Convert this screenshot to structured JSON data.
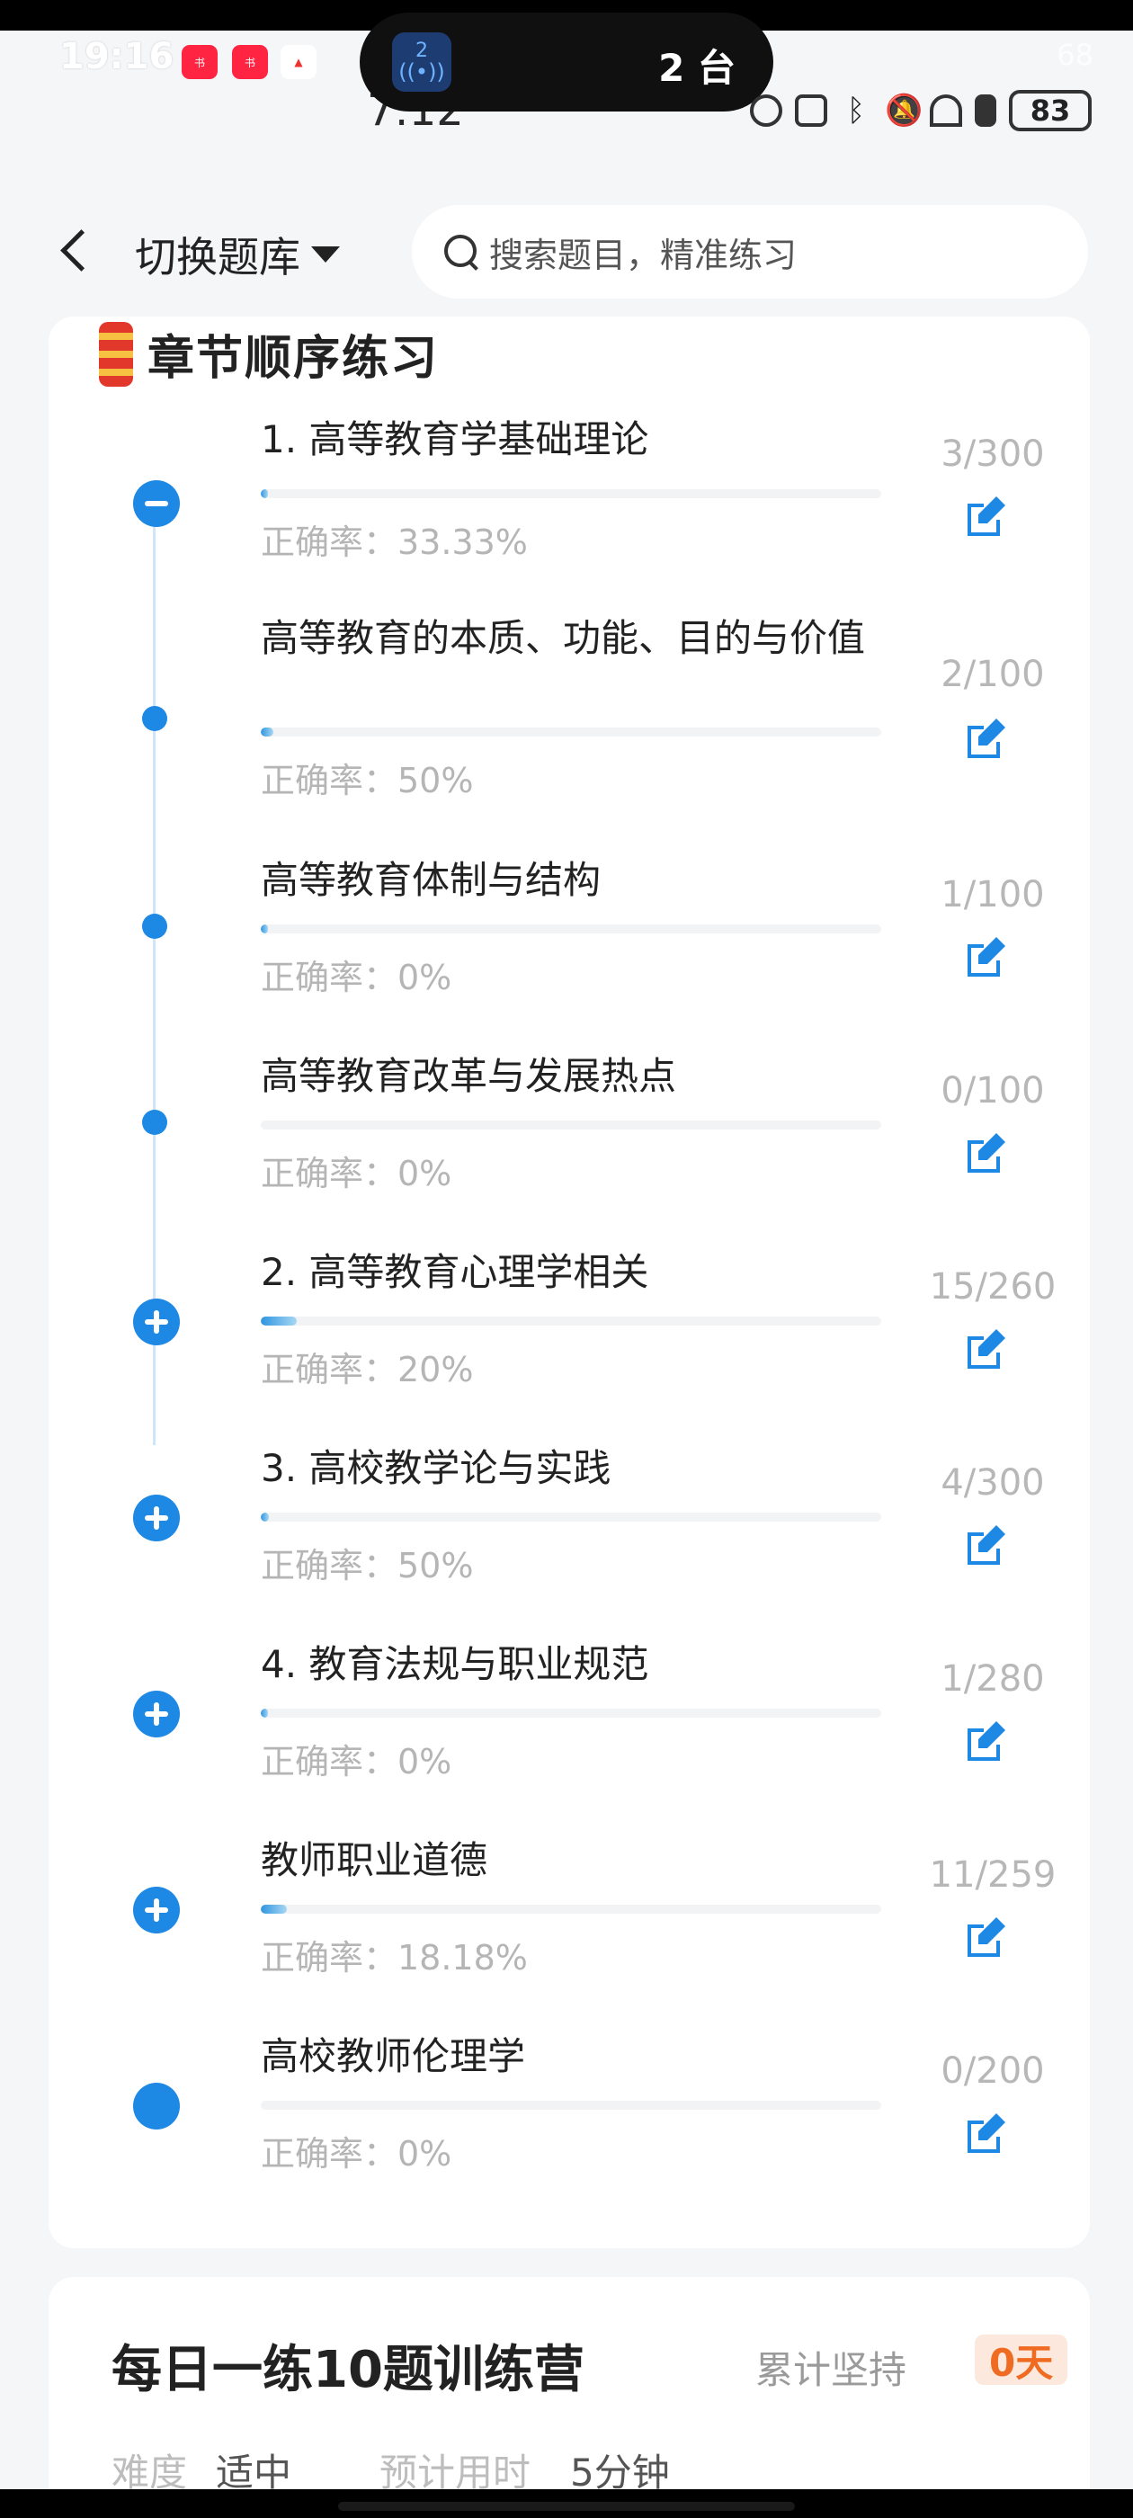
{
  "status_bar": {
    "ghost_time": "19:16",
    "time": "7:12",
    "island_badge": "2",
    "island_text": "2 台",
    "battery_ghost": "68",
    "battery": "83"
  },
  "header": {
    "switch_bank_label": "切换题库",
    "search_placeholder": "搜索题目，精准练习"
  },
  "chapter_card": {
    "title": "章节顺序练习",
    "items": [
      {
        "title": "1. 高等教育学基础理论",
        "count": "3/300",
        "accuracy": "正确率：33.33%",
        "progress": 0.01,
        "node": "minus"
      },
      {
        "title": "高等教育的本质、功能、目的与价值",
        "count": "2/100",
        "accuracy": "正确率：50%",
        "progress": 0.02,
        "node": "dot"
      },
      {
        "title": "高等教育体制与结构",
        "count": "1/100",
        "accuracy": "正确率：0%",
        "progress": 0.01,
        "node": "dot"
      },
      {
        "title": "高等教育改革与发展热点",
        "count": "0/100",
        "accuracy": "正确率：0%",
        "progress": 0.0,
        "node": "dot"
      },
      {
        "title": "2. 高等教育心理学相关",
        "count": "15/260",
        "accuracy": "正确率：20%",
        "progress": 0.058,
        "node": "plus"
      },
      {
        "title": "3. 高校教学论与实践",
        "count": "4/300",
        "accuracy": "正确率：50%",
        "progress": 0.013,
        "node": "plus"
      },
      {
        "title": "4. 教育法规与职业规范",
        "count": "1/280",
        "accuracy": "正确率：0%",
        "progress": 0.004,
        "node": "plus"
      },
      {
        "title": "教师职业道德",
        "count": "11/259",
        "accuracy": "正确率：18.18%",
        "progress": 0.042,
        "node": "plus"
      },
      {
        "title": "高校教师伦理学",
        "count": "0/200",
        "accuracy": "正确率：0%",
        "progress": 0.0,
        "node": "filled"
      }
    ]
  },
  "daily_card": {
    "title": "每日一练10题训练营",
    "streak_label": "累计坚持",
    "streak_value": "0天",
    "difficulty_label": "难度",
    "difficulty_value": "适中",
    "time_label": "预计用时",
    "time_value": "5分钟"
  },
  "colors": {
    "accent": "#1e88e5",
    "progress_light": "#a7d7f3",
    "streak": "#f06b22"
  }
}
